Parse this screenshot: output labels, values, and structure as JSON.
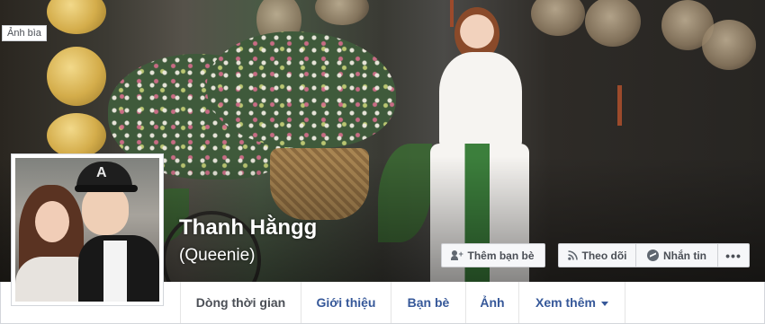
{
  "cover": {
    "label": "Ảnh bìa"
  },
  "profile": {
    "name": "Thanh Hằngg",
    "alternate_name": "(Queenie)",
    "cap_logo": "A"
  },
  "actions": {
    "add_friend_label": "Thêm bạn bè",
    "follow_label": "Theo dõi",
    "message_label": "Nhắn tin",
    "more_label": "•••"
  },
  "nav": {
    "tabs": [
      {
        "label": "Dòng thời gian",
        "active": true
      },
      {
        "label": "Giới thiệu",
        "active": false
      },
      {
        "label": "Bạn bè",
        "active": false
      },
      {
        "label": "Ảnh",
        "active": false
      },
      {
        "label": "Xem thêm",
        "active": false
      }
    ]
  },
  "icons": {
    "add_friend": "add-friend-icon",
    "follow": "rss-icon",
    "message": "messenger-icon",
    "more_tab": "caret-down-icon"
  },
  "colors": {
    "link": "#365899",
    "active_tab": "#4b4f56",
    "button_bg": "#f6f7f9",
    "page_bg": "#e9ebee"
  }
}
